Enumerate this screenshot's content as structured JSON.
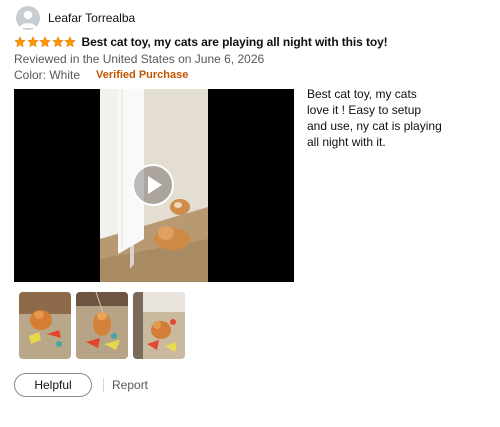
{
  "reviewer": {
    "name": "Leafar Torrealba",
    "avatar_icon": "person-icon"
  },
  "review": {
    "rating": 5,
    "rating_max": 5,
    "star_color": "#ff9900",
    "title": "Best cat toy, my cats are playing all night with this toy!",
    "date_line": "Reviewed in the United States on June 6, 2026",
    "color_option": "Color: White",
    "verified_label": "Verified Purchase",
    "verified_color": "#c45500",
    "body": "Best cat toy, my cats love it ! Easy to setup and use, ny cat is playing all night with it."
  },
  "media": {
    "video_play_icon": "play-icon",
    "thumbnail_count": 3
  },
  "actions": {
    "helpful_label": "Helpful",
    "report_label": "Report"
  }
}
